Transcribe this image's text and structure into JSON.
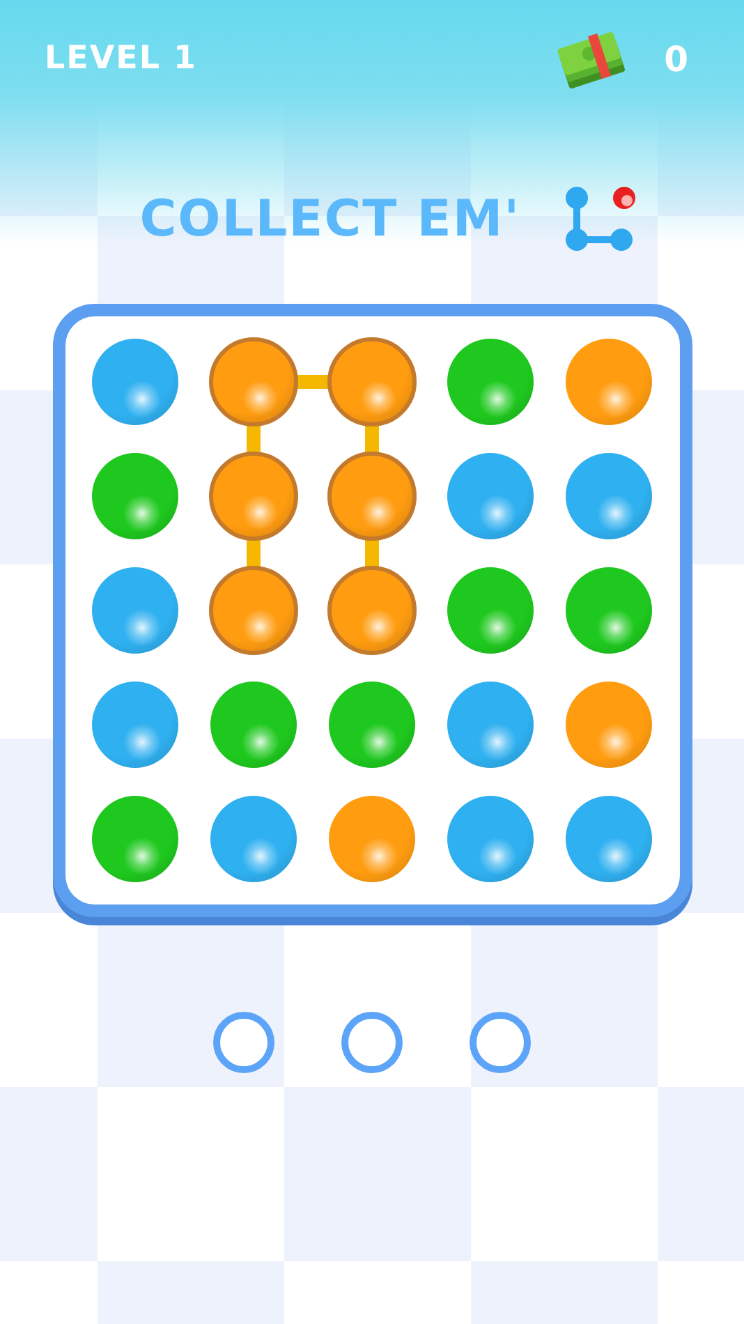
{
  "header": {
    "level": "LEVEL 1",
    "coins": "0"
  },
  "goal": {
    "title": "COLLECT EM'"
  },
  "board": {
    "rows": [
      [
        {
          "color": "#2fb0f0",
          "selected": false,
          "link_right": false,
          "link_down": false
        },
        {
          "color": "#ff9c10",
          "selected": true,
          "link_right": true,
          "link_down": true
        },
        {
          "color": "#ff9c10",
          "selected": true,
          "link_right": false,
          "link_down": true
        },
        {
          "color": "#1ec81e",
          "selected": false,
          "link_right": false,
          "link_down": false
        },
        {
          "color": "#ff9c10",
          "selected": false,
          "link_right": false,
          "link_down": false
        }
      ],
      [
        {
          "color": "#1ec81e",
          "selected": false,
          "link_right": false,
          "link_down": false
        },
        {
          "color": "#ff9c10",
          "selected": true,
          "link_right": false,
          "link_down": true
        },
        {
          "color": "#ff9c10",
          "selected": true,
          "link_right": false,
          "link_down": true
        },
        {
          "color": "#2fb0f0",
          "selected": false,
          "link_right": false,
          "link_down": false
        },
        {
          "color": "#2fb0f0",
          "selected": false,
          "link_right": false,
          "link_down": false
        }
      ],
      [
        {
          "color": "#2fb0f0",
          "selected": false,
          "link_right": false,
          "link_down": false
        },
        {
          "color": "#ff9c10",
          "selected": true,
          "link_right": false,
          "link_down": false
        },
        {
          "color": "#ff9c10",
          "selected": true,
          "link_right": false,
          "link_down": false
        },
        {
          "color": "#1ec81e",
          "selected": false,
          "link_right": false,
          "link_down": false
        },
        {
          "color": "#1ec81e",
          "selected": false,
          "link_right": false,
          "link_down": false
        }
      ],
      [
        {
          "color": "#2fb0f0",
          "selected": false,
          "link_right": false,
          "link_down": false
        },
        {
          "color": "#1ec81e",
          "selected": false,
          "link_right": false,
          "link_down": false
        },
        {
          "color": "#1ec81e",
          "selected": false,
          "link_right": false,
          "link_down": false
        },
        {
          "color": "#2fb0f0",
          "selected": false,
          "link_right": false,
          "link_down": false
        },
        {
          "color": "#ff9c10",
          "selected": false,
          "link_right": false,
          "link_down": false
        }
      ],
      [
        {
          "color": "#1ec81e",
          "selected": false,
          "link_right": false,
          "link_down": false
        },
        {
          "color": "#2fb0f0",
          "selected": false,
          "link_right": false,
          "link_down": false
        },
        {
          "color": "#ff9c10",
          "selected": false,
          "link_right": false,
          "link_down": false
        },
        {
          "color": "#2fb0f0",
          "selected": false,
          "link_right": false,
          "link_down": false
        },
        {
          "color": "#2fb0f0",
          "selected": false,
          "link_right": false,
          "link_down": false
        }
      ]
    ]
  },
  "slots": [
    {
      "filled": false
    },
    {
      "filled": false
    },
    {
      "filled": false
    }
  ]
}
